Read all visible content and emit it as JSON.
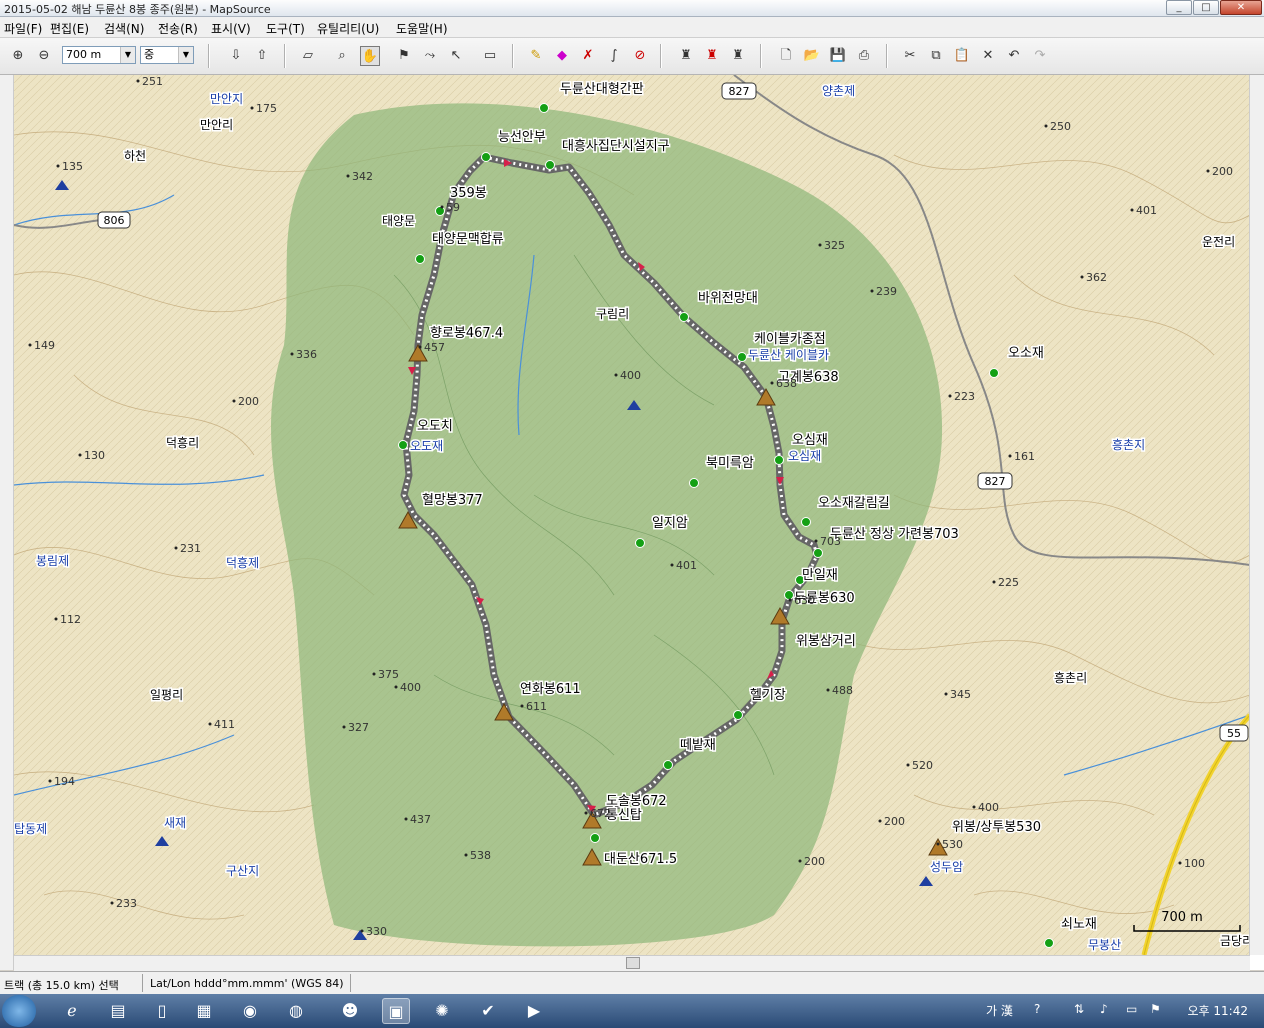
{
  "window": {
    "title": "2015-05-02 해남 두륜산 8봉 종주(원본) - MapSource",
    "minimize": "_",
    "maximize": "□",
    "close": "✕"
  },
  "menu": [
    "파일(F)",
    "편집(E)",
    "검색(N)",
    "전송(R)",
    "표시(V)",
    "도구(T)",
    "유틸리티(U)",
    "도움말(H)"
  ],
  "toolbar": {
    "zoom_value": "700 m",
    "detail_value": "중",
    "icons": [
      "zoom-in-icon",
      "zoom-out-icon",
      "receive-device-icon",
      "send-device-icon",
      "select-tool-icon",
      "zoom-tool-icon",
      "hand-tool-icon",
      "waypoint-tool-icon",
      "route-tool-icon",
      "track-tool-icon",
      "measure-tool-icon",
      "new-file-icon",
      "open-file-icon",
      "save-icon",
      "print-icon",
      "cut-icon",
      "copy-icon",
      "paste-icon",
      "delete-icon",
      "undo-icon",
      "redo-icon"
    ]
  },
  "map": {
    "colors": {
      "terrain": "#ede4c4",
      "forest": "#8fb77a",
      "track": "#888888",
      "road": "#f2d32e",
      "water": "#4a90d9"
    },
    "waypoints": [
      {
        "label": "두륜산대형간판"
      },
      {
        "label": "능선안부"
      },
      {
        "label": "대흥사집단시설지구"
      },
      {
        "label": "359봉"
      },
      {
        "label": "태양문맥합류"
      },
      {
        "label": "바위전망대"
      },
      {
        "label": "케이블카종점"
      },
      {
        "label": "향로봉467.4"
      },
      {
        "label": "고계봉638"
      },
      {
        "label": "오심재"
      },
      {
        "label": "오도치"
      },
      {
        "label": "북미륵암"
      },
      {
        "label": "혈망봉377"
      },
      {
        "label": "오소재갈림길"
      },
      {
        "label": "두륜산 정상 가련봉703"
      },
      {
        "label": "일지암"
      },
      {
        "label": "만일재"
      },
      {
        "label": "두륜봉630"
      },
      {
        "label": "위봉삼거리"
      },
      {
        "label": "연화봉611"
      },
      {
        "label": "헬기장"
      },
      {
        "label": "떼밭재"
      },
      {
        "label": "도솔봉672"
      },
      {
        "label": "통신탑"
      },
      {
        "label": "대둔산671.5"
      },
      {
        "label": "위봉/상투봉530"
      },
      {
        "label": "오소재"
      },
      {
        "label": "쇠노재"
      }
    ],
    "places": [
      "만안지",
      "만안리",
      "하천",
      "구림리",
      "덕흥리",
      "봉림제",
      "덕흥제",
      "일평리",
      "탑동제",
      "새재",
      "구산지",
      "양촌제",
      "운전리",
      "흥촌지",
      "흥촌리",
      "성두암",
      "금당리",
      "무봉산",
      "오도재",
      "오심재",
      "두륜산 케이블카",
      "태양문"
    ],
    "elevations": [
      "251",
      "175",
      "135",
      "342",
      "149",
      "336",
      "130",
      "231",
      "112",
      "375",
      "411",
      "327",
      "194",
      "437",
      "538",
      "233",
      "330",
      "400",
      "401",
      "250",
      "401",
      "362",
      "325",
      "239",
      "223",
      "161",
      "225",
      "345",
      "488",
      "520",
      "100",
      "400",
      "400",
      "200",
      "200",
      "200",
      "200",
      "59",
      "457",
      "638",
      "703",
      "630",
      "611",
      "672",
      "530"
    ],
    "road_numbers": [
      "806",
      "827",
      "827",
      "55"
    ],
    "scale_label": "700 m"
  },
  "status": {
    "track_info": "트랙 (총 15.0 km) 선택",
    "coord_format": "Lat/Lon hddd°mm.mmm' (WGS 84)"
  },
  "taskbar": {
    "lang": "가 漢",
    "clock": "오후 11:42"
  }
}
